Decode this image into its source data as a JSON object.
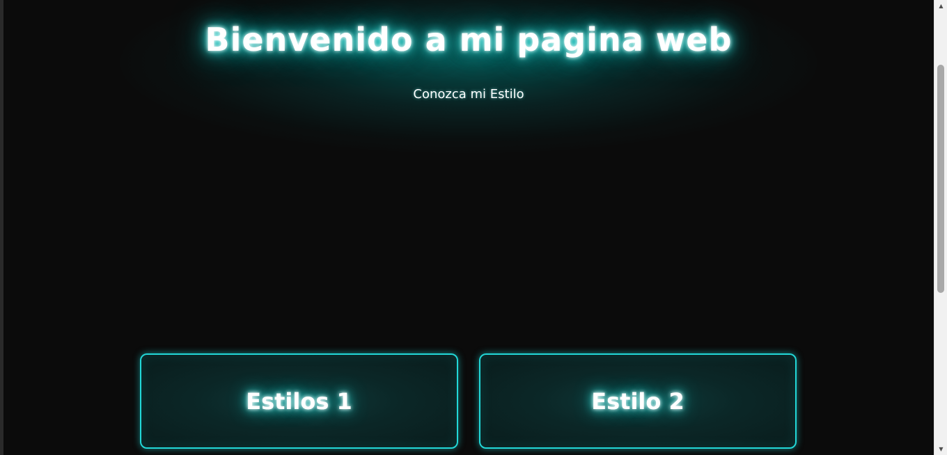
{
  "hero": {
    "title": "Bienvenido a mi pagina web",
    "subtitle": "Conozca mi Estilo"
  },
  "cards": [
    {
      "label": "Estilos 1"
    },
    {
      "label": "Estilo 2"
    }
  ],
  "scrollbar": {
    "up_arrow": "▲",
    "down_arrow": "▼",
    "scroll_position": 0.26
  },
  "colors": {
    "background": "#0b0b0b",
    "accent": "#22d8d8",
    "glow": "#18c8c4",
    "text": "#ffffff"
  }
}
